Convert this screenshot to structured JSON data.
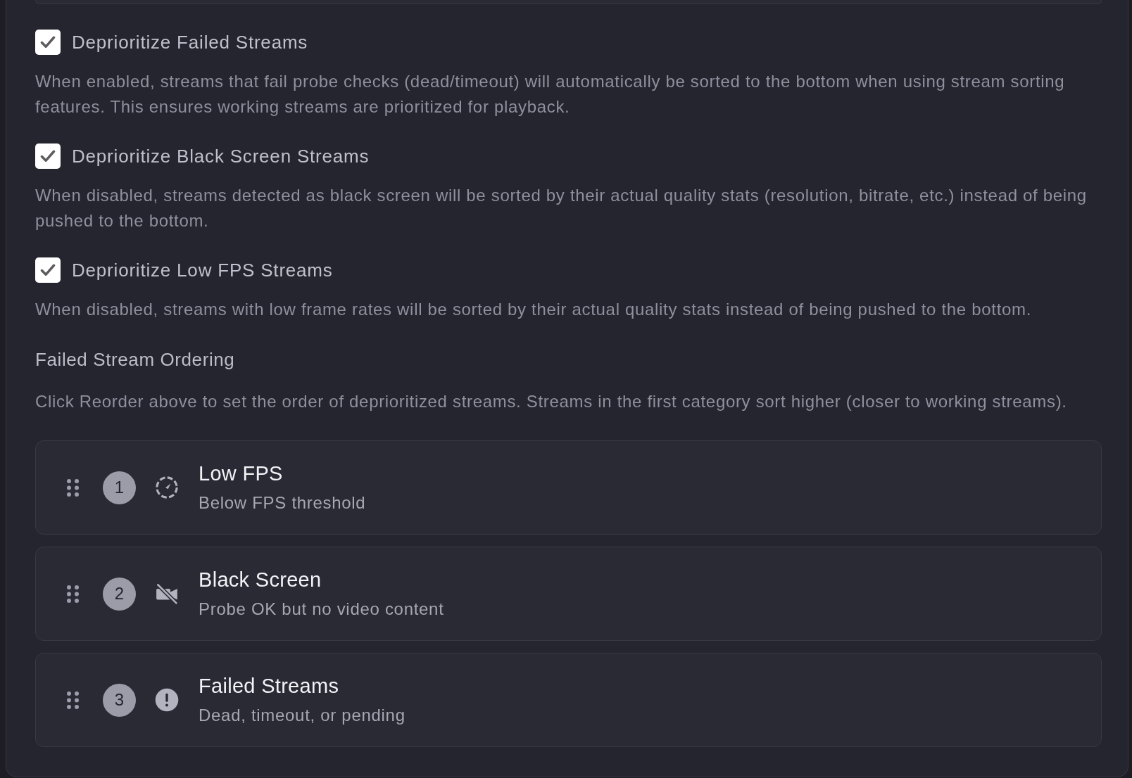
{
  "options": [
    {
      "label": "Deprioritize Failed Streams",
      "checked": true,
      "description": "When enabled, streams that fail probe checks (dead/timeout) will automatically be sorted to the bottom when using stream sorting features. This ensures working streams are prioritized for playback."
    },
    {
      "label": "Deprioritize Black Screen Streams",
      "checked": true,
      "description": "When disabled, streams detected as black screen will be sorted by their actual quality stats (resolution, bitrate, etc.) instead of being pushed to the bottom."
    },
    {
      "label": "Deprioritize Low FPS Streams",
      "checked": true,
      "description": "When disabled, streams with low frame rates will be sorted by their actual quality stats instead of being pushed to the bottom."
    }
  ],
  "ordering": {
    "title": "Failed Stream Ordering",
    "description": "Click Reorder above to set the order of deprioritized streams. Streams in the first category sort higher (closer to working streams).",
    "items": [
      {
        "rank": "1",
        "kind": "low_fps",
        "title": "Low FPS",
        "subtitle": "Below FPS threshold"
      },
      {
        "rank": "2",
        "kind": "black_screen",
        "title": "Black Screen",
        "subtitle": "Probe OK but no video content"
      },
      {
        "rank": "3",
        "kind": "failed",
        "title": "Failed Streams",
        "subtitle": "Dead, timeout, or pending"
      }
    ]
  }
}
